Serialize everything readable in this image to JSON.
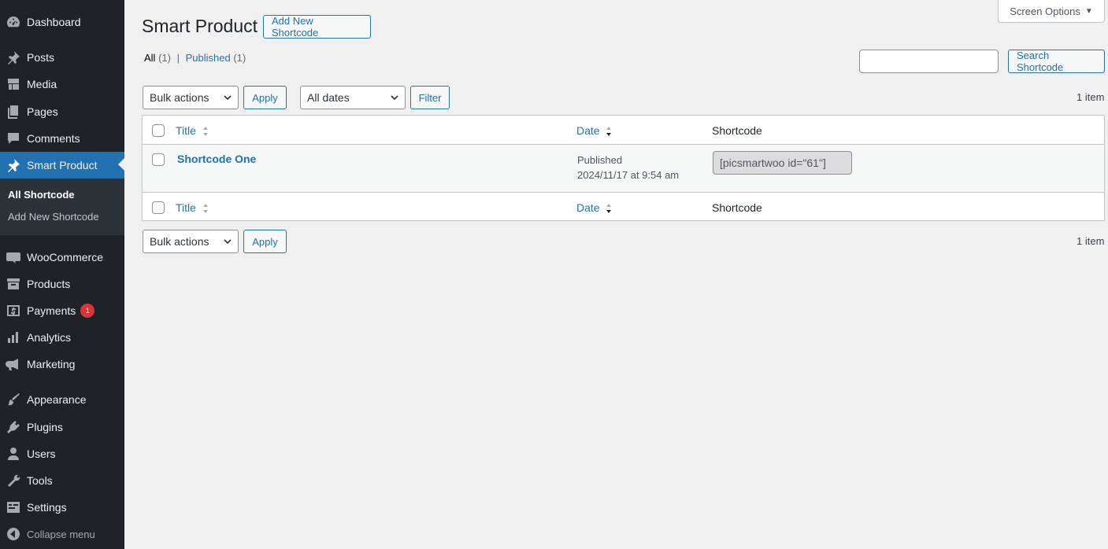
{
  "sidebar": {
    "items": [
      {
        "label": "Dashboard",
        "icon": "dashboard-icon"
      },
      {
        "label": "Posts",
        "icon": "pin-icon"
      },
      {
        "label": "Media",
        "icon": "media-icon"
      },
      {
        "label": "Pages",
        "icon": "pages-icon"
      },
      {
        "label": "Comments",
        "icon": "comment-icon"
      },
      {
        "label": "Smart Product",
        "icon": "pin-icon"
      },
      {
        "label": "WooCommerce",
        "icon": "woo-icon"
      },
      {
        "label": "Products",
        "icon": "archive-icon"
      },
      {
        "label": "Payments",
        "icon": "payments-icon",
        "badge": "1"
      },
      {
        "label": "Analytics",
        "icon": "chart-bar-icon"
      },
      {
        "label": "Marketing",
        "icon": "megaphone-icon"
      },
      {
        "label": "Appearance",
        "icon": "paintbrush-icon"
      },
      {
        "label": "Plugins",
        "icon": "plugin-icon"
      },
      {
        "label": "Users",
        "icon": "user-icon"
      },
      {
        "label": "Tools",
        "icon": "wrench-icon"
      },
      {
        "label": "Settings",
        "icon": "settings-icon"
      }
    ],
    "submenu": [
      "All Shortcode",
      "Add New Shortcode"
    ],
    "collapse_label": "Collapse menu"
  },
  "header": {
    "title": "Smart Product",
    "add_new_label": "Add New Shortcode",
    "screen_options_label": "Screen Options"
  },
  "filters": {
    "all_label": "All",
    "all_count": "(1)",
    "separator": "|",
    "published_label": "Published",
    "published_count": "(1)",
    "search_button": "Search Shortcode",
    "search_value": "",
    "bulk_actions": "Bulk actions",
    "apply": "Apply",
    "all_dates": "All dates",
    "filter": "Filter",
    "item_count": "1 item"
  },
  "table": {
    "columns": {
      "title": "Title",
      "date": "Date",
      "shortcode": "Shortcode"
    },
    "rows": [
      {
        "title": "Shortcode One",
        "status": "Published",
        "date": "2024/11/17 at 9:54 am",
        "shortcode": "[picsmartwoo id=\"61\"]"
      }
    ]
  },
  "colors": {
    "sidebar_bg": "#1d2327",
    "accent": "#2271b1",
    "badge": "#d63638"
  }
}
